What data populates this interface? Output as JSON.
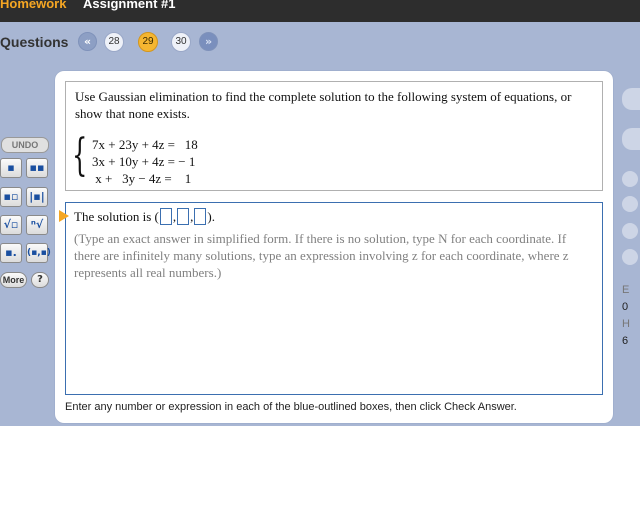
{
  "header": {
    "homework_label": "Homework",
    "assignment_label": "Assignment #1"
  },
  "question_nav": {
    "label": "Questions",
    "prev_icon": "double-chevron-left-icon",
    "next_icon": "double-chevron-right-icon",
    "questions": [
      "28",
      "29",
      "30"
    ],
    "current": "29"
  },
  "toolbox": {
    "undo_label": "UNDO",
    "buttons": [
      {
        "name": "fraction-button",
        "glyph": "▪"
      },
      {
        "name": "mixed-number-button",
        "glyph": "▪▪"
      },
      {
        "name": "exponent-button",
        "glyph": "▪▫"
      },
      {
        "name": "absolute-value-button",
        "glyph": "|▪|"
      },
      {
        "name": "square-root-button",
        "glyph": "√▫"
      },
      {
        "name": "nth-root-button",
        "glyph": "ⁿ√"
      },
      {
        "name": "subscript-button",
        "glyph": "▪."
      },
      {
        "name": "ordered-pair-button",
        "glyph": "(▪,▪)"
      }
    ],
    "more_label": "More",
    "help_label": "?"
  },
  "question": {
    "prompt": "Use Gaussian elimination to find the complete solution to the following system of equations, or show that none exists.",
    "equations": [
      "7x + 23y + 4z =   18",
      "3x + 10y + 4z = − 1",
      " x +   3y − 4z =    1"
    ]
  },
  "answer": {
    "prefix": "The solution is (",
    "sep1": ",",
    "sep2": ",",
    "suffix": ").",
    "instructions": "(Type an exact answer in simplified form. If there is no solution, type N for each coordinate. If there are infinitely many solutions, type an expression involving z for each coordinate, where z represents all real numbers.)"
  },
  "footer": {
    "hint": "Enter any number or expression in each of the blue-outlined boxes, then click Check Answer."
  },
  "right_panel": {
    "fragments": [
      "E",
      "0",
      "H",
      "6"
    ]
  },
  "colors": {
    "accent": "#f5a623",
    "band": "#a8b6d3",
    "input_border": "#3b6fb0",
    "topbar": "#2d2d2d"
  }
}
